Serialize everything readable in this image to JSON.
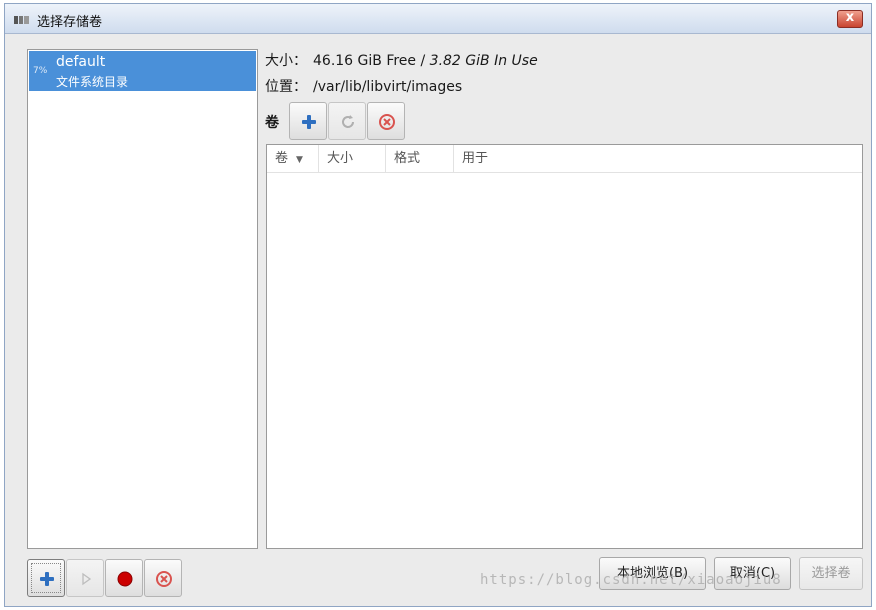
{
  "window": {
    "title": "选择存储卷",
    "close_label": "x"
  },
  "pools": [
    {
      "usage": "7%",
      "name": "default",
      "type": "文件系统目录",
      "selected": true
    }
  ],
  "info": {
    "size_label": "大小：",
    "size_free": "46.16 GiB Free / ",
    "size_in_use": "3.82 GiB In Use",
    "location_label": "位置：",
    "location_value": "/var/lib/libvirt/images"
  },
  "volumes": {
    "label": "卷",
    "columns": [
      "卷",
      "大小",
      "格式",
      "用于"
    ],
    "rows": []
  },
  "actions": {
    "browse_local": "本地浏览(B)",
    "cancel": "取消(C)",
    "choose_volume": "选择卷"
  },
  "watermark": "https://blog.csdn.net/xiaoaojiu8",
  "colors": {
    "selection": "#4a90d9",
    "add_icon": "#2e6fc0",
    "delete_icon": "#d9534f",
    "stop_icon": "#cc0000"
  }
}
